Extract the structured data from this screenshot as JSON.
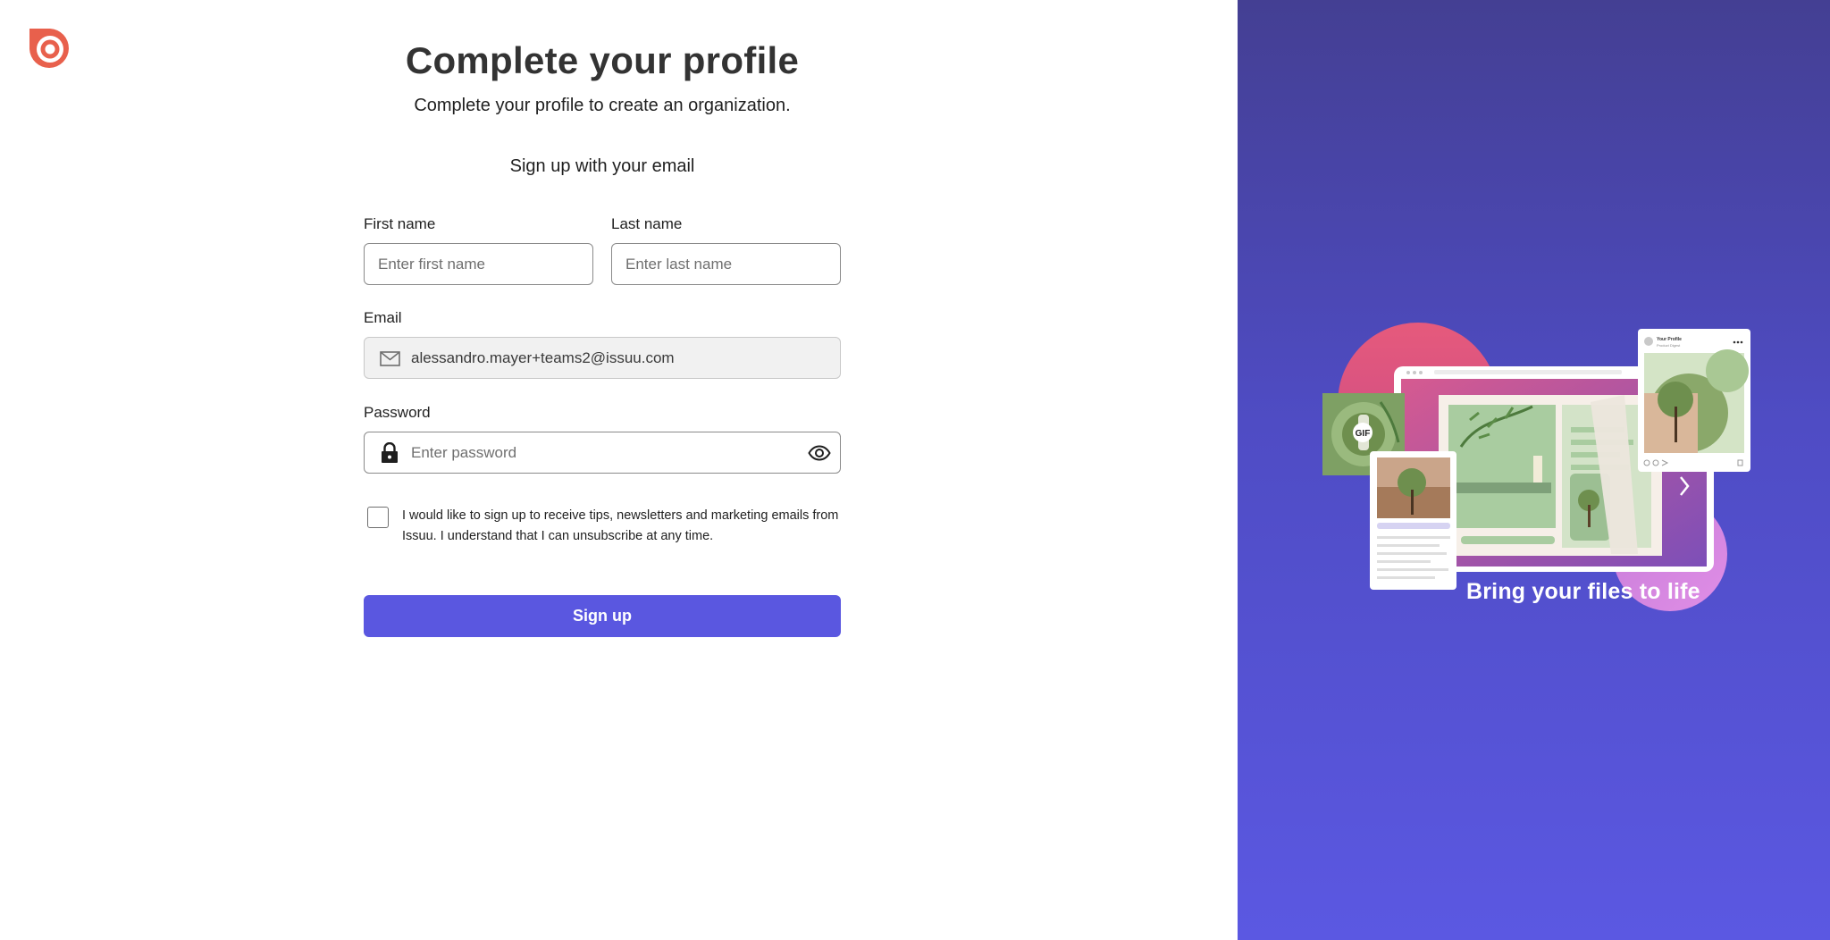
{
  "brand": {
    "name": "Issuu",
    "accent": "#e8604c",
    "button_color": "#5a57e0"
  },
  "header": {
    "title": "Complete your profile",
    "subtitle": "Complete your profile to create an organization."
  },
  "form": {
    "section_title": "Sign up with your email",
    "first_name": {
      "label": "First name",
      "placeholder": "Enter first name",
      "value": ""
    },
    "last_name": {
      "label": "Last name",
      "placeholder": "Enter last name",
      "value": ""
    },
    "email": {
      "label": "Email",
      "value": "alessandro.mayer+teams2@issuu.com",
      "icon": "mail-icon"
    },
    "password": {
      "label": "Password",
      "placeholder": "Enter password",
      "value": "",
      "icon": "lock-icon",
      "toggle_icon": "eye-icon"
    },
    "consent": {
      "checked": false,
      "text": "I would like to sign up to receive tips, newsletters and marketing emails from Issuu. I understand that I can unsubscribe at any time."
    },
    "submit_label": "Sign up"
  },
  "promo": {
    "tagline": "Bring your files to life",
    "gif_badge": "GIF",
    "card_title": "Your Profile",
    "card_subtitle": "Product Digest"
  }
}
